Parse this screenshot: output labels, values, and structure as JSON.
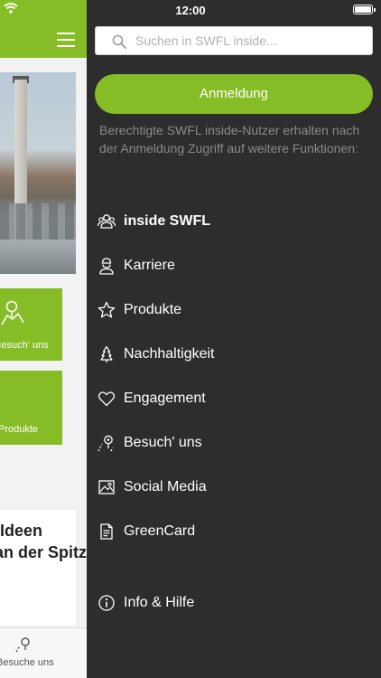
{
  "status_bar": {
    "time": "12:00"
  },
  "background_app": {
    "tile_visit_label": "Besuch' uns",
    "tile_products_label": "Produkte",
    "card_line1": "Ideen",
    "card_line2": "an der Spitz",
    "tabbar_label": "Besuche uns"
  },
  "drawer": {
    "search": {
      "placeholder": "Suchen in SWFL inside..."
    },
    "login_button": "Anmeldung",
    "login_note": "Berechtigte SWFL inside-Nutzer erhalten nach der Anmeldung Zugriff auf weitere Funktionen:",
    "menu": [
      {
        "label": "inside SWFL",
        "icon": "people-icon",
        "active": true
      },
      {
        "label": "Karriere",
        "icon": "worker-icon"
      },
      {
        "label": "Produkte",
        "icon": "star-icon"
      },
      {
        "label": "Nachhaltigkeit",
        "icon": "tree-icon"
      },
      {
        "label": "Engagement",
        "icon": "heart-icon"
      },
      {
        "label": "Besuch' uns",
        "icon": "map-pin-icon"
      },
      {
        "label": "Social Media",
        "icon": "image-icon"
      },
      {
        "label": "GreenCard",
        "icon": "document-icon"
      },
      {
        "label": "Info & Hilfe",
        "icon": "info-icon"
      }
    ]
  },
  "colors": {
    "accent": "#86bc25",
    "drawer_bg": "#2d2d2d",
    "note_text": "#8a8a8a"
  }
}
